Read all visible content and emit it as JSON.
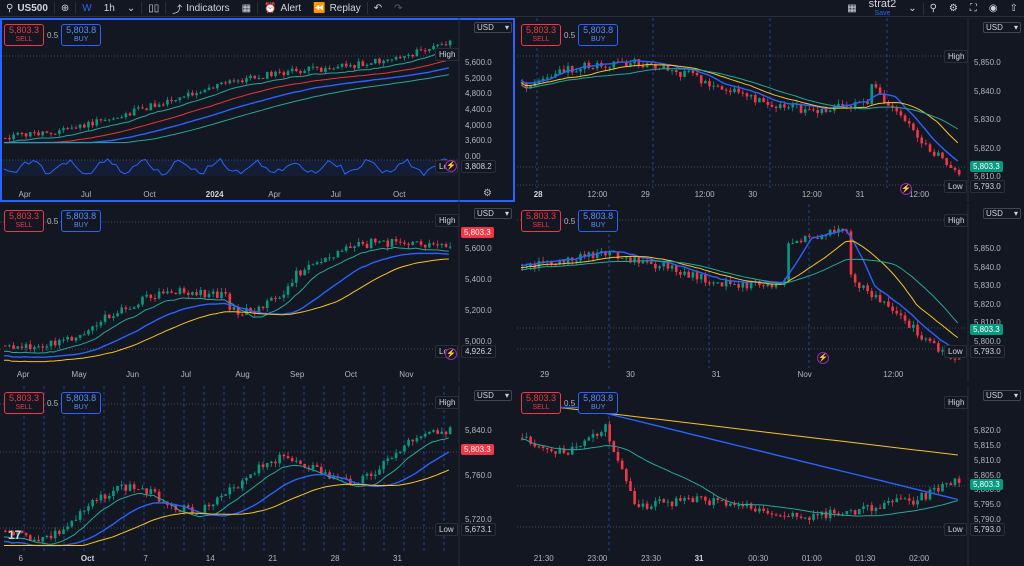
{
  "toolbar": {
    "symbol": "US500",
    "interval_w": "W",
    "interval_h": "1h",
    "indicators": "Indicators",
    "alert": "Alert",
    "replay": "Replay",
    "layout_name": "strat2",
    "layout_status": "Save"
  },
  "common": {
    "sell_price": "5,803.3",
    "sell_label": "SELL",
    "buy_price": "5,803.8",
    "buy_label": "BUY",
    "spread": "0.5",
    "currency": "USD",
    "high_label": "High",
    "low_label": "Low",
    "last_price": "5,803.3"
  },
  "colors": {
    "bg": "#131722",
    "up": "#089981",
    "down": "#f23645",
    "ma_blue": "#2962ff",
    "ma_green": "#26a69a",
    "ma_yellow": "#f7c325",
    "ma_red": "#e53935",
    "accent": "#2962ff"
  },
  "panes": [
    {
      "id": "weekly",
      "interval": "W",
      "low_value": "3,808.2",
      "price_tag_color": "none",
      "y_ticks": [
        "5,600.0",
        "5,200.0",
        "4,800.0",
        "4,400.0",
        "4,000.0",
        "3,600.0",
        "0.00"
      ],
      "x_ticks": [
        "Apr",
        "Jul",
        "Oct",
        "2024",
        "Apr",
        "Jul",
        "Oct"
      ],
      "x_bold": [
        false,
        false,
        false,
        true,
        false,
        false,
        false
      ]
    },
    {
      "id": "m5-a",
      "interval": "5m",
      "low_value": "5,793.0",
      "price_tag_color": "green",
      "y_ticks": [
        "5,850.0",
        "5,840.0",
        "5,830.0",
        "5,820.0",
        "5,810.0"
      ],
      "x_ticks": [
        "28",
        "12:00",
        "29",
        "12:00",
        "30",
        "12:00",
        "31",
        "12:00"
      ],
      "x_bold": [
        true,
        false,
        false,
        false,
        false,
        false,
        false,
        false
      ]
    },
    {
      "id": "daily",
      "interval": "D",
      "low_value": "4,926.2",
      "price_tag_color": "red",
      "y_ticks": [
        "5,600.0",
        "5,400.0",
        "5,200.0",
        "5,000.0"
      ],
      "x_ticks": [
        "Apr",
        "May",
        "Jun",
        "Jul",
        "Aug",
        "Sep",
        "Oct",
        "Nov"
      ],
      "x_bold": [
        false,
        false,
        false,
        false,
        false,
        false,
        false,
        false
      ]
    },
    {
      "id": "m5-b",
      "interval": "5m",
      "low_value": "5,793.0",
      "price_tag_color": "green",
      "y_ticks": [
        "5,850.0",
        "5,840.0",
        "5,830.0",
        "5,820.0",
        "5,810.0",
        "5,800.0"
      ],
      "x_ticks": [
        "29",
        "30",
        "31",
        "Nov",
        "12:00"
      ],
      "x_bold": [
        false,
        false,
        false,
        false,
        false
      ]
    },
    {
      "id": "hourly",
      "interval": "1h",
      "low_value": "5,673.1",
      "price_tag_color": "red",
      "y_ticks": [
        "5,840.0",
        "5,760.0",
        "5,720.0"
      ],
      "x_ticks": [
        "6",
        "Oct",
        "7",
        "14",
        "21",
        "28",
        "31"
      ],
      "x_bold": [
        false,
        true,
        false,
        false,
        false,
        false,
        false
      ]
    },
    {
      "id": "m1",
      "interval": "1m",
      "low_value": "5,793.0",
      "price_tag_color": "green",
      "y_ticks": [
        "5,820.0",
        "5,815.0",
        "5,810.0",
        "5,805.0",
        "5,800.0",
        "5,795.0",
        "5,790.0"
      ],
      "x_ticks": [
        "21:30",
        "23:00",
        "23:30",
        "31",
        "00:30",
        "01:00",
        "01:30",
        "02:00"
      ],
      "x_bold": [
        false,
        false,
        false,
        true,
        false,
        false,
        false,
        false
      ]
    }
  ]
}
